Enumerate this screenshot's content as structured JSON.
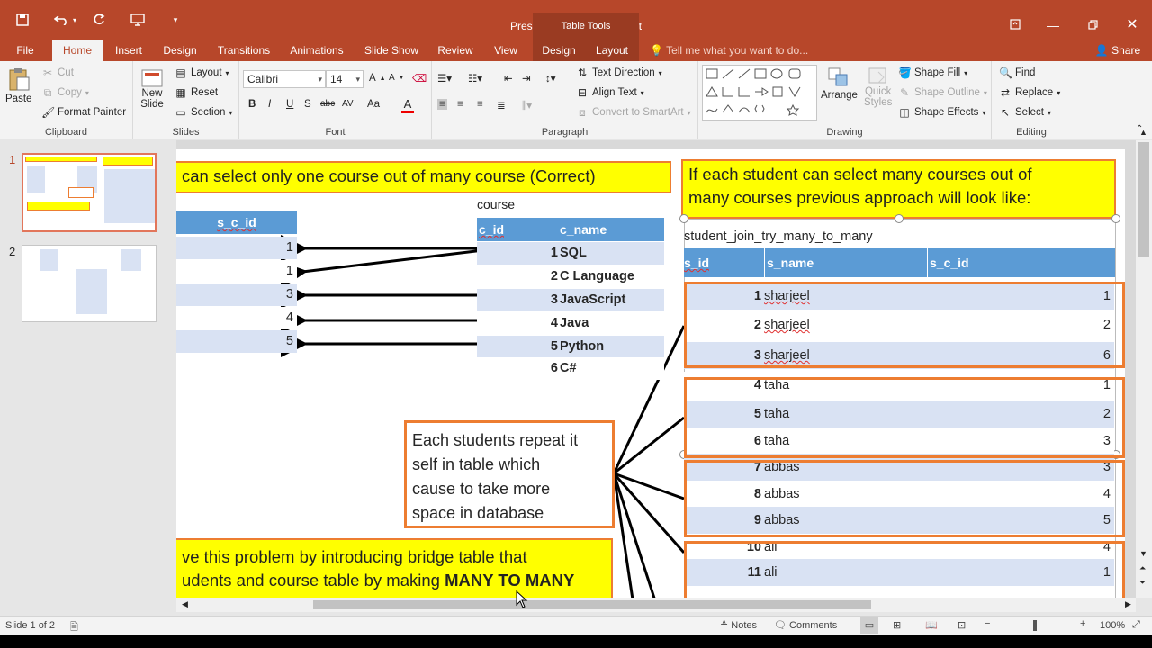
{
  "titlebar": {
    "title": "Presentation1 - PowerPoint",
    "context_tab_group": "Table Tools",
    "qat": {
      "save": "save-icon",
      "undo": "undo-icon",
      "redo": "redo-icon"
    }
  },
  "tabs": [
    "File",
    "Home",
    "Insert",
    "Design",
    "Transitions",
    "Animations",
    "Slide Show",
    "Review",
    "View",
    "Design",
    "Layout"
  ],
  "tell_me": "Tell me what you want to do...",
  "share": "Share",
  "ribbon": {
    "clipboard": {
      "paste": "Paste",
      "cut": "Cut",
      "copy": "Copy",
      "format_painter": "Format Painter",
      "label": "Clipboard"
    },
    "slides": {
      "new_slide_1": "New",
      "new_slide_2": "Slide",
      "layout": "Layout",
      "reset": "Reset",
      "section": "Section",
      "label": "Slides"
    },
    "font": {
      "family": "Calibri",
      "size": "14",
      "label": "Font",
      "bold": "B",
      "italic": "I",
      "underline": "U",
      "shadow": "S",
      "strike": "abc",
      "spacing": "AV",
      "case": "Aa"
    },
    "paragraph": {
      "text_direction": "Text Direction",
      "align_text": "Align Text",
      "smartart": "Convert to SmartArt",
      "label": "Paragraph"
    },
    "drawing": {
      "arrange": "Arrange",
      "quick_styles_1": "Quick",
      "quick_styles_2": "Styles",
      "shape_fill": "Shape Fill",
      "shape_outline": "Shape Outline",
      "shape_effects": "Shape Effects",
      "label": "Drawing"
    },
    "editing": {
      "find": "Find",
      "replace": "Replace",
      "select": "Select",
      "label": "Editing"
    }
  },
  "thumbs": {
    "n1": "1",
    "n2": "2"
  },
  "slide": {
    "left_banner": "can select only one course out of many course (Correct)",
    "left_table": {
      "header": "s_c_id",
      "values": [
        "1",
        "1",
        "3",
        "4",
        "5"
      ]
    },
    "course_caption": "course",
    "course_table": {
      "headers": [
        "c_id",
        "c_name"
      ],
      "rows": [
        {
          "id": "1",
          "name": "SQL"
        },
        {
          "id": "2",
          "name": "C Language"
        },
        {
          "id": "3",
          "name": "JavaScript"
        },
        {
          "id": "4",
          "name": "Java"
        },
        {
          "id": "5",
          "name": "Python"
        },
        {
          "id": "6",
          "name": "C#"
        }
      ]
    },
    "right_banner_line1": "If each student can select many courses out of",
    "right_banner_line2": "many courses previous approach will look like:",
    "join_caption": "student_join_try_many_to_many",
    "join_table": {
      "headers": [
        "s_id",
        "s_name",
        "s_c_id"
      ],
      "rows": [
        {
          "s_id": "1",
          "s_name": "sharjeel",
          "s_c_id": "1"
        },
        {
          "s_id": "2",
          "s_name": "sharjeel",
          "s_c_id": "2"
        },
        {
          "s_id": "3",
          "s_name": "sharjeel",
          "s_c_id": "6"
        },
        {
          "s_id": "4",
          "s_name": "taha",
          "s_c_id": "1"
        },
        {
          "s_id": "5",
          "s_name": "taha",
          "s_c_id": "2"
        },
        {
          "s_id": "6",
          "s_name": "taha",
          "s_c_id": "3"
        },
        {
          "s_id": "7",
          "s_name": "abbas",
          "s_c_id": "3"
        },
        {
          "s_id": "8",
          "s_name": "abbas",
          "s_c_id": "4"
        },
        {
          "s_id": "9",
          "s_name": "abbas",
          "s_c_id": "5"
        },
        {
          "s_id": "10",
          "s_name": "ali",
          "s_c_id": "4"
        },
        {
          "s_id": "11",
          "s_name": "ali",
          "s_c_id": "1"
        }
      ]
    },
    "callout_lines": [
      "Each students repeat it",
      "self in table which",
      "cause to take more",
      "space in database"
    ],
    "bottom_banner_line1": "ve this problem by introducing bridge table that",
    "bottom_banner_line2_a": "udents and course table by making ",
    "bottom_banner_line2_b": "MANY TO MANY"
  },
  "status": {
    "slide_info": "Slide 1 of 2",
    "notes": "Notes",
    "comments": "Comments",
    "zoom": "100%"
  },
  "colors": {
    "accent": "#b7472a",
    "table_header": "#5b9bd5",
    "table_band": "#d9e2f3",
    "highlight": "#ffff00",
    "orange": "#ed7d31"
  }
}
